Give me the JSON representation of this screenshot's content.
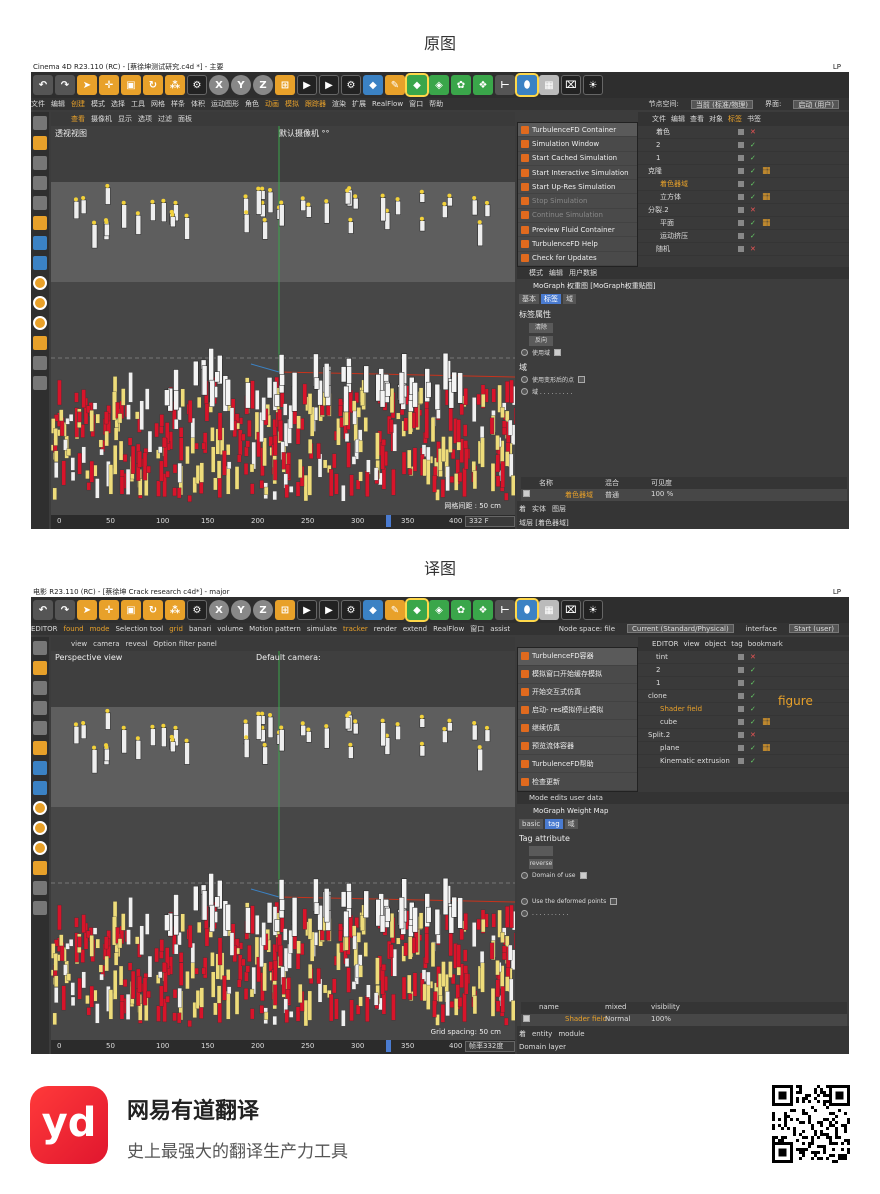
{
  "sections": {
    "original_title": "原图",
    "translated_title": "译图"
  },
  "original": {
    "window_title": "Cinema 4D R23.110 (RC) - [蔡徐坤测试研究.c4d *] - 主要",
    "window_right": "LP",
    "menu": [
      "文件",
      "编辑",
      "创建",
      "模式",
      "选择",
      "工具",
      "网格",
      "样条",
      "体积",
      "运动图形",
      "角色",
      "动画",
      "模拟",
      "跟踪器",
      "渲染",
      "扩展",
      "RealFlow",
      "窗口",
      "帮助"
    ],
    "menu_node_space_label": "节点空间:",
    "menu_node_space_value": "当前 (标准/物理)",
    "menu_interface_label": "界面:",
    "menu_interface_value": "启动 (用户)",
    "viewport_menu": [
      "查看",
      "摄像机",
      "显示",
      "选项",
      "过滤",
      "面板"
    ],
    "viewport_label": "透视视图",
    "camera_label": "默认摄像机 °°",
    "grid_label": "网格间距 : 50 cm",
    "popup_items": [
      "TurbulenceFD Container",
      "Simulation Window",
      "Start Cached Simulation",
      "Start Interactive Simulation",
      "Start Up-Res Simulation",
      "Stop Simulation",
      "Continue Simulation",
      "Preview Fluid Container",
      "TurbulenceFD Help",
      "Check for Updates"
    ],
    "object_menu": [
      "文件",
      "编辑",
      "查看",
      "对象",
      "标签",
      "书签"
    ],
    "objects": [
      "着色",
      "2",
      "1",
      "克隆",
      "着色器域",
      "立方体",
      "分裂.2",
      "平面",
      "运动挤压",
      "随机"
    ],
    "attr_menu": [
      "模式",
      "编辑",
      "用户数据"
    ],
    "attr_title": "MoGraph 权重图 [MoGraph权重贴图]",
    "attr_tabs": [
      "基本",
      "标签",
      "域"
    ],
    "tag_section": "标签属性",
    "btn_clear": "清除",
    "btn_invert": "反向",
    "use_field": "使用域",
    "field_section": "域",
    "use_deformed": "使用变形后的点",
    "field_label": "域 . . . . . . . . .",
    "table_headers": [
      "名称",
      "混合",
      "可见度"
    ],
    "table_row": [
      "着色器域",
      "普通",
      "100 %"
    ],
    "layer_labels": [
      "着",
      "实体",
      "图层"
    ],
    "layer_bottom": "域层 [着色器域]",
    "timeline_marks": [
      "0",
      "50",
      "100",
      "150",
      "200",
      "250",
      "300",
      "350",
      "400"
    ],
    "frame": "332 F"
  },
  "translated": {
    "window_title": "电影      R23.110 (RC)   - [蔡徐坤 Crack research c4d*] - major",
    "window_right": "LP",
    "menu": [
      "EDITOR",
      "found",
      "mode",
      "Selection tool",
      "grid",
      "banari",
      "volume",
      "Motion pattern",
      "simulate",
      "tracker",
      "render",
      "extend",
      "RealFlow",
      "窗口",
      "assist"
    ],
    "menu_node_space_label": "Node space: file",
    "menu_node_space_value": "Current (Standard/Physical)",
    "menu_interface_label": "interface",
    "menu_interface_value": "Start (user)",
    "viewport_menu": [
      "view",
      "camera",
      "reveal",
      "Option filter panel"
    ],
    "viewport_label": "Perspective view",
    "camera_label": "Default camera:",
    "grid_label": "Grid spacing: 50 cm",
    "popup_items": [
      "TurbulenceFD容器",
      "模拟窗口开始缓存模拟",
      "开始交互式仿真",
      "启动- res模拟停止模拟",
      "继续仿真",
      "预览流体容器",
      "TurbulenceFD帮助",
      "检查更新"
    ],
    "object_menu": [
      "EDITOR",
      "view",
      "object",
      "tag",
      "bookmark"
    ],
    "objects": [
      "tint",
      "2",
      "1",
      "clone",
      "Shader field",
      "cube",
      "Split.2",
      "plane",
      "Kinematic extrusion"
    ],
    "figure_tag": "figure",
    "attr_menu": [
      "Mode edits user data"
    ],
    "attr_title": "MoGraph Weight Map",
    "attr_tabs": [
      "basic",
      "tag",
      "域"
    ],
    "tag_section": "Tag attribute",
    "btn_reverse": "reverse",
    "use_field": "Domain of use",
    "use_deformed": "Use the deformed points",
    "field_label": ". . . . . . . . . .",
    "table_headers": [
      "name",
      "mixed",
      "visibility"
    ],
    "table_row": [
      "Shader field",
      "Normal",
      "100%"
    ],
    "layer_labels": [
      "着",
      "entity",
      "module"
    ],
    "layer_bottom": "Domain layer",
    "timeline_marks": [
      "0",
      "50",
      "100",
      "150",
      "200",
      "250",
      "300",
      "350",
      "400"
    ],
    "frame": "帧率332度"
  },
  "brand": {
    "logo": "yd",
    "name": "网易有道翻译",
    "slogan": "史上最强大的翻译生产力工具"
  },
  "colors": {
    "accent": "#e8a12a",
    "red": "#e0162e",
    "blue": "#4a7bd0"
  }
}
